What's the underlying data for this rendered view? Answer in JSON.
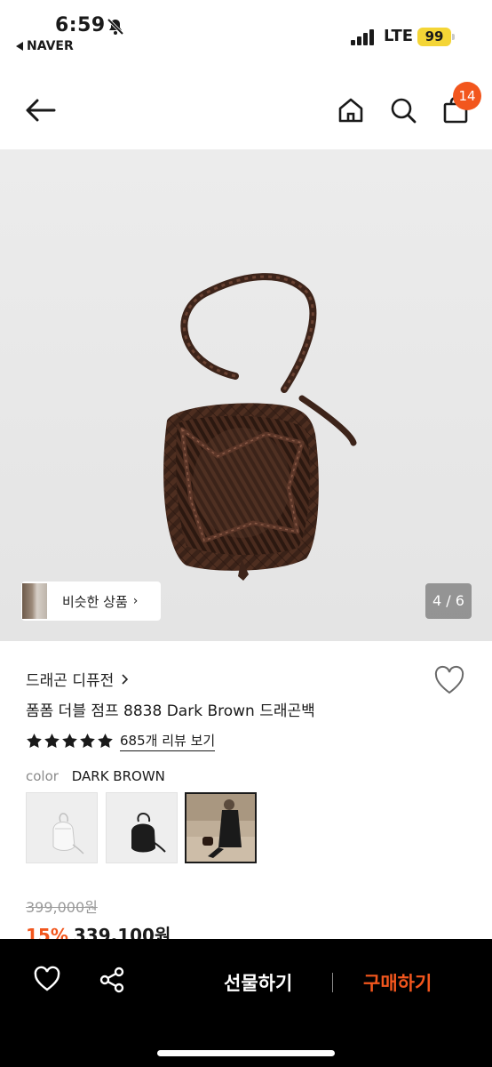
{
  "status_bar": {
    "time": "6:59",
    "back_app": "NAVER",
    "network": "LTE",
    "battery": "99"
  },
  "header": {
    "cart_count": "14"
  },
  "gallery": {
    "similar_label": "비슷한 상품",
    "page_indicator": "4 / 6"
  },
  "product": {
    "brand": "드래곤 디퓨전",
    "name": "폼폼 더블 점프 8838 Dark Brown 드래곤백",
    "rating_stars": 5,
    "review_link": "685개 리뷰 보기",
    "option_label": "color",
    "option_value": "DARK BROWN",
    "swatches": [
      "white",
      "black",
      "dark-brown-model"
    ],
    "original_price": "399,000원",
    "discount": "15%",
    "price": "339,100원"
  },
  "bottom_bar": {
    "gift_label": "선물하기",
    "buy_label": "구매하기"
  },
  "colors": {
    "accent": "#f2561d",
    "battery": "#f4d536"
  }
}
